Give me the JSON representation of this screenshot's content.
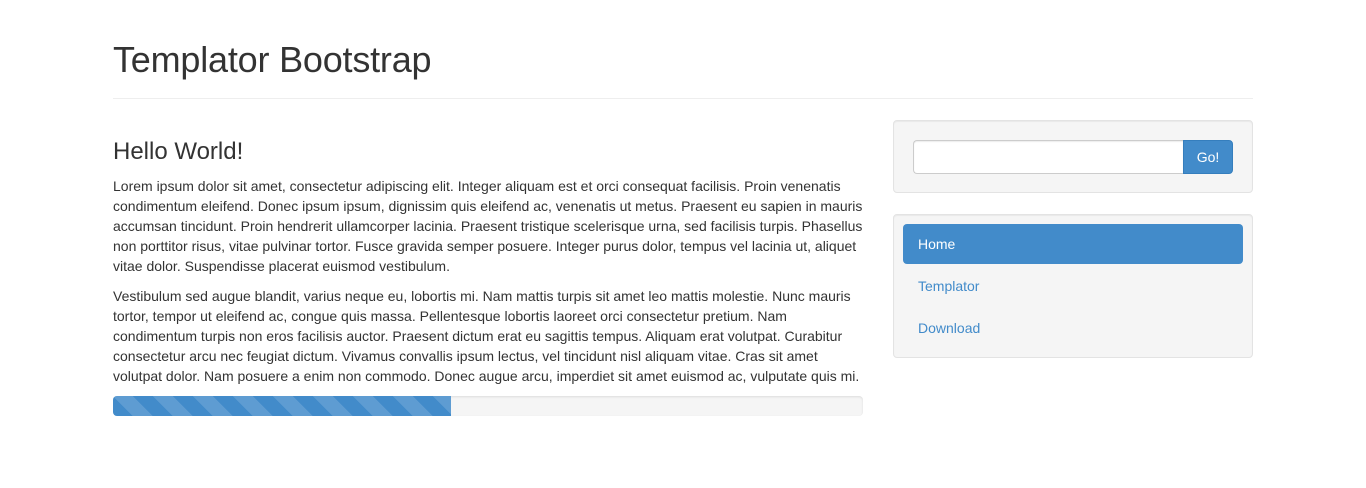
{
  "header": {
    "title": "Templator Bootstrap"
  },
  "main": {
    "heading": "Hello World!",
    "paragraphs": [
      "Lorem ipsum dolor sit amet, consectetur adipiscing elit. Integer aliquam est et orci consequat facilisis. Proin venenatis condimentum eleifend. Donec ipsum ipsum, dignissim quis eleifend ac, venenatis ut metus. Praesent eu sapien in mauris accumsan tincidunt. Proin hendrerit ullamcorper lacinia. Praesent tristique scelerisque urna, sed facilisis turpis. Phasellus non porttitor risus, vitae pulvinar tortor. Fusce gravida semper posuere. Integer purus dolor, tempus vel lacinia ut, aliquet vitae dolor. Suspendisse placerat euismod vestibulum.",
      "Vestibulum sed augue blandit, varius neque eu, lobortis mi. Nam mattis turpis sit amet leo mattis molestie. Nunc mauris tortor, tempor ut eleifend ac, congue quis massa. Pellentesque lobortis laoreet orci consectetur pretium. Nam condimentum turpis non eros facilisis auctor. Praesent dictum erat eu sagittis tempus. Aliquam erat volutpat. Curabitur consectetur arcu nec feugiat dictum. Vivamus convallis ipsum lectus, vel tincidunt nisl aliquam vitae. Cras sit amet volutpat dolor. Nam posuere a enim non commodo. Donec augue arcu, imperdiet sit amet euismod ac, vulputate quis mi."
    ],
    "progress": {
      "percent": 45,
      "color": "#428bca",
      "striped": true
    }
  },
  "sidebar": {
    "search": {
      "value": "",
      "placeholder": "",
      "button_label": "Go!"
    },
    "nav": [
      {
        "label": "Home",
        "active": true
      },
      {
        "label": "Templator",
        "active": false
      },
      {
        "label": "Download",
        "active": false
      }
    ]
  },
  "colors": {
    "accent": "#428bca",
    "well_background": "#f5f5f5",
    "text": "#333333"
  }
}
